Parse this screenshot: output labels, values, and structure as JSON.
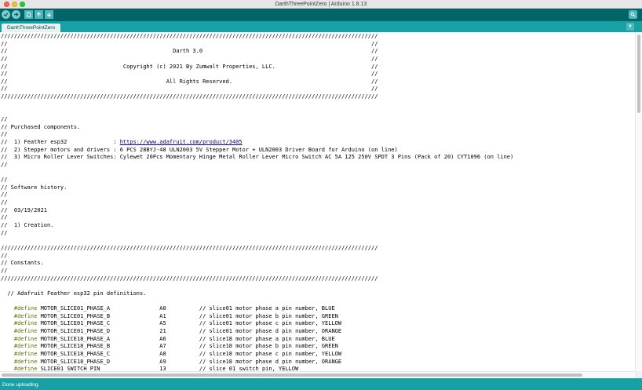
{
  "window": {
    "title": "DarthThreePointZero | Arduino 1.8.13"
  },
  "toolbar": {
    "verify_icon": "check-icon",
    "upload_icon": "arrow-right-icon",
    "new_icon": "new-file-icon",
    "open_icon": "arrow-up-icon",
    "save_icon": "arrow-down-icon",
    "serial_monitor_icon": "magnifier-icon"
  },
  "tabs": [
    {
      "label": "DarthThreePointZero",
      "active": true
    }
  ],
  "status": {
    "text": "Done uploading."
  },
  "colors": {
    "toolbar_bg": "#006468",
    "tabbar_bg": "#17a1a5",
    "status_bg": "#17a1a5",
    "keyword": "#5e6d03",
    "link": "#000080"
  },
  "code_lines": [
    "//////////////////////////////////////////////////////////////////////////////////////////////////////////////////",
    "//                                                                                                              //",
    "//                                                  Darth 3.0                                                   //",
    "//                                                                                                              //",
    "//                                   Copyright (c) 2021 By Zumwalt Properties, LLC.                             //",
    "//                                                                                                              //",
    "//                                                All Rights Reserved.                                          //",
    "//                                                                                                              //",
    "//////////////////////////////////////////////////////////////////////////////////////////////////////////////////",
    "",
    "",
    "//",
    "// Purchased components.",
    "//",
    "//  1) Feather esp32              : https://www.adafruit.com/product/3405",
    "//  2) Stepper motors and drivers : 6 PCS 28BYJ-48 ULN2003 5V Stepper Motor + ULN2003 Driver Board for Arduino (on line)",
    "//  3) Micro Roller Lever Switches: Cylewet 20Pcs Momentary Hinge Metal Roller Lever Micro Switch AC 5A 125 250V SPDT 3 Pins (Pack of 20) CYT1096 (on line)",
    "//",
    "",
    "//",
    "// Software history.",
    "//",
    "//",
    "//  03/19/2021",
    "//",
    "//  1) Creation.",
    "//",
    "",
    "//////////////////////////////////////////////////////////////////////////////////////////////////////////////////",
    "//",
    "// Constants.",
    "//",
    "//////////////////////////////////////////////////////////////////////////////////////////////////////////////////",
    "",
    "  // Adafruit Feather esp32 pin definitions.",
    "",
    "    #define MOTOR_SLICE01_PHASE_A               A0          // slice01 motor phase a pin number, BLUE",
    "    #define MOTOR_SLICE01_PHASE_B               A1          // slice01 motor phase b pin number, GREEN",
    "    #define MOTOR_SLICE01_PHASE_C               A5          // slice01 motor phase c pin number, YELLOW",
    "    #define MOTOR_SLICE01_PHASE_D               21          // slice01 motor phase d pin number, ORANGE",
    "    #define MOTOR_SLICE18_PHASE_A               A6          // slice18 motor phase a pin number, BLUE",
    "    #define MOTOR_SLICE18_PHASE_B               A7          // slice18 motor phase b pin number, GREEN",
    "    #define MOTOR_SLICE18_PHASE_C               A8          // slice18 motor phase c pin number, YELLOW",
    "    #define MOTOR_SLICE18_PHASE_D               A9          // slice18 motor phase d pin number, ORANGE",
    "    #define SLICE01_SWITCH_PIN                  13          // slice 01 switch pin, YELLOW"
  ]
}
